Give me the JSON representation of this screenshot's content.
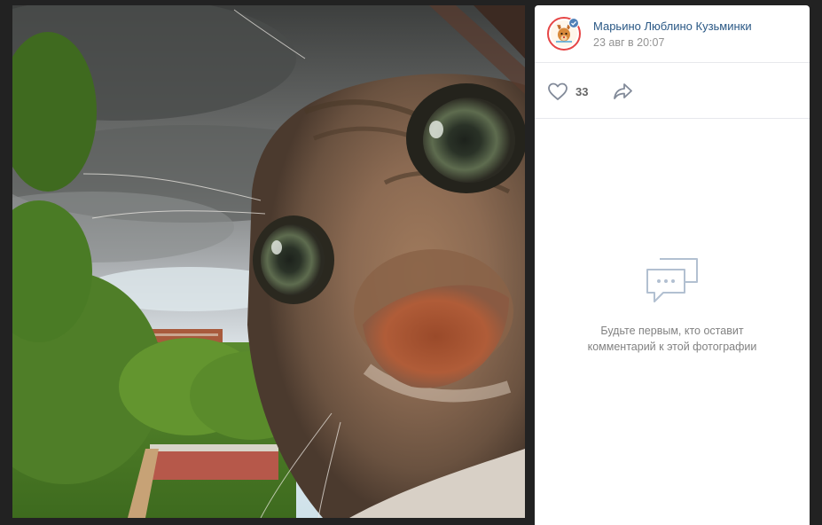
{
  "post": {
    "author": "Марьино Люблино Кузьминки",
    "date": "23 авг в 20:07",
    "likes": "33"
  },
  "comments": {
    "empty_text": "Будьте первым, кто оставит комментарий к этой фотографии"
  },
  "photo": {
    "subject": "cat-closeup-fisheye"
  },
  "icons": {
    "like": "heart-icon",
    "share": "share-arrow-icon",
    "comments": "speech-bubbles-icon",
    "verified": "verified-check-icon",
    "avatar": "deer-logo"
  },
  "colors": {
    "link": "#2a5885",
    "muted": "#939393",
    "verified": "#5181b8",
    "avatar_ring": "#e64646"
  }
}
